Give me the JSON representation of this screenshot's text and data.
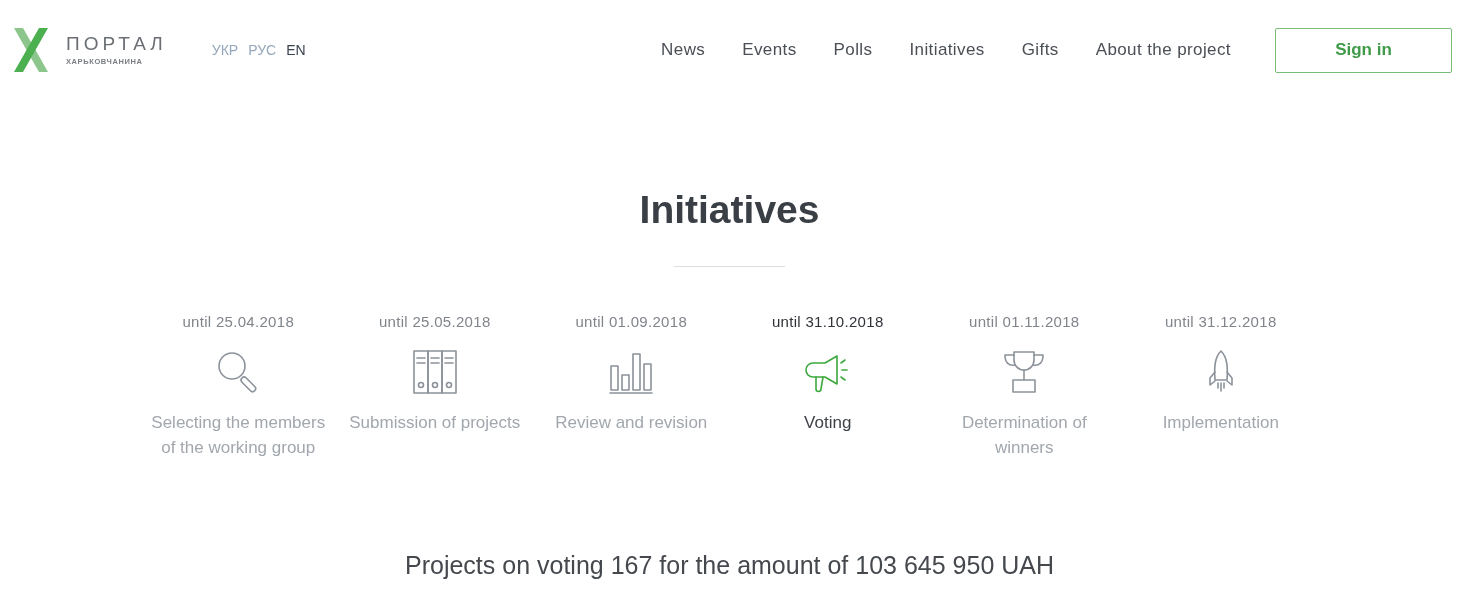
{
  "logo": {
    "title": "ПОРТАЛ",
    "subtitle": "ХАРЬКОВЧАНИНА"
  },
  "languages": [
    {
      "label": "УКР",
      "selected": false
    },
    {
      "label": "РУС",
      "selected": false
    },
    {
      "label": "EN",
      "selected": true
    }
  ],
  "nav": [
    "News",
    "Events",
    "Polls",
    "Initiatives",
    "Gifts",
    "About the project"
  ],
  "sign_in": "Sign in",
  "page_title": "Initiatives",
  "stages": [
    {
      "kind": "search",
      "date": "until 25.04.2018",
      "label": "Selecting the members of the working group",
      "current": false
    },
    {
      "kind": "binders",
      "date": "until 25.05.2018",
      "label": "Submission of projects",
      "current": false
    },
    {
      "kind": "bars",
      "date": "until 01.09.2018",
      "label": "Review and revision",
      "current": false
    },
    {
      "kind": "megaphone",
      "date": "until 31.10.2018",
      "label": "Voting",
      "current": true
    },
    {
      "kind": "trophy",
      "date": "until 01.11.2018",
      "label": "Determination of winners",
      "current": false
    },
    {
      "kind": "rocket",
      "date": "until 31.12.2018",
      "label": "Implementation",
      "current": false
    }
  ],
  "summary": "Projects on voting 167 for the amount of 103 645 950 UAH"
}
